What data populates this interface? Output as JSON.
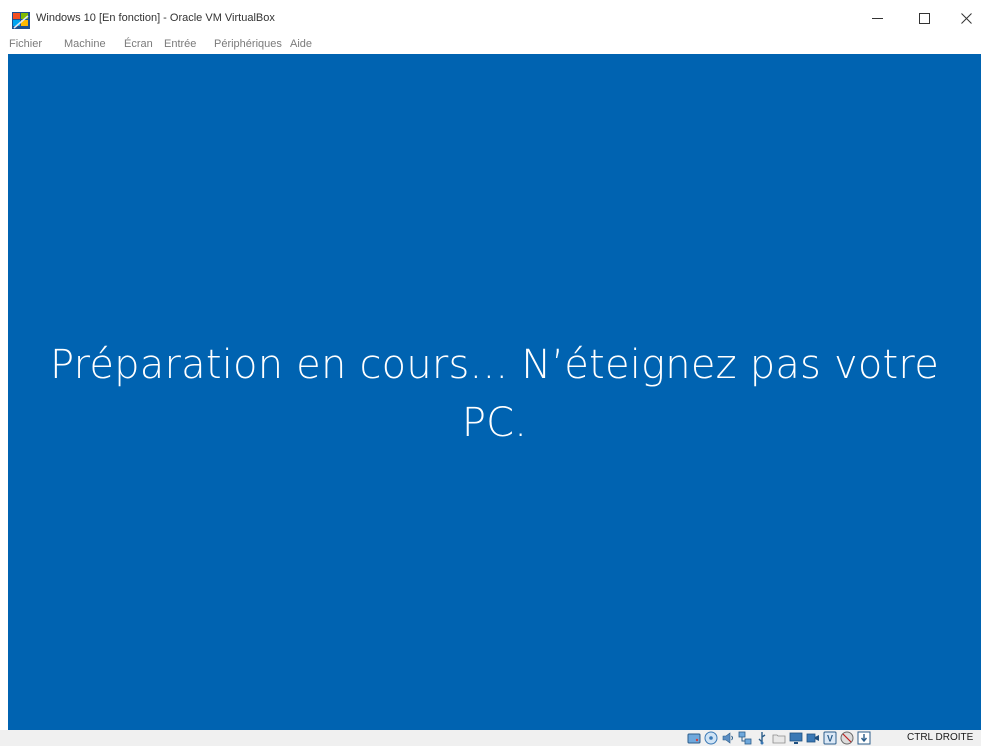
{
  "window": {
    "title": "Windows 10 [En fonction] - Oracle VM VirtualBox",
    "controls": {
      "minimize_icon": "minimize-icon",
      "maximize_icon": "maximize-icon",
      "close_icon": "close-icon"
    }
  },
  "menubar": {
    "items": [
      "Fichier",
      "Machine",
      "Écran",
      "Entrée",
      "Périphériques",
      "Aide"
    ]
  },
  "guest": {
    "background_color": "#0063b1",
    "message_line1": "Préparation en cours... N’éteignez pas votre",
    "message_line2": "PC."
  },
  "statusbar": {
    "icons": [
      "hard-disk-icon",
      "optical-drive-icon",
      "audio-icon",
      "network-icon",
      "usb-icon",
      "shared-folders-icon",
      "display-icon",
      "video-capture-icon",
      "virtualization-icon",
      "recording-icon",
      "keyboard-capture-icon"
    ],
    "host_key": "CTRL DROITE"
  }
}
